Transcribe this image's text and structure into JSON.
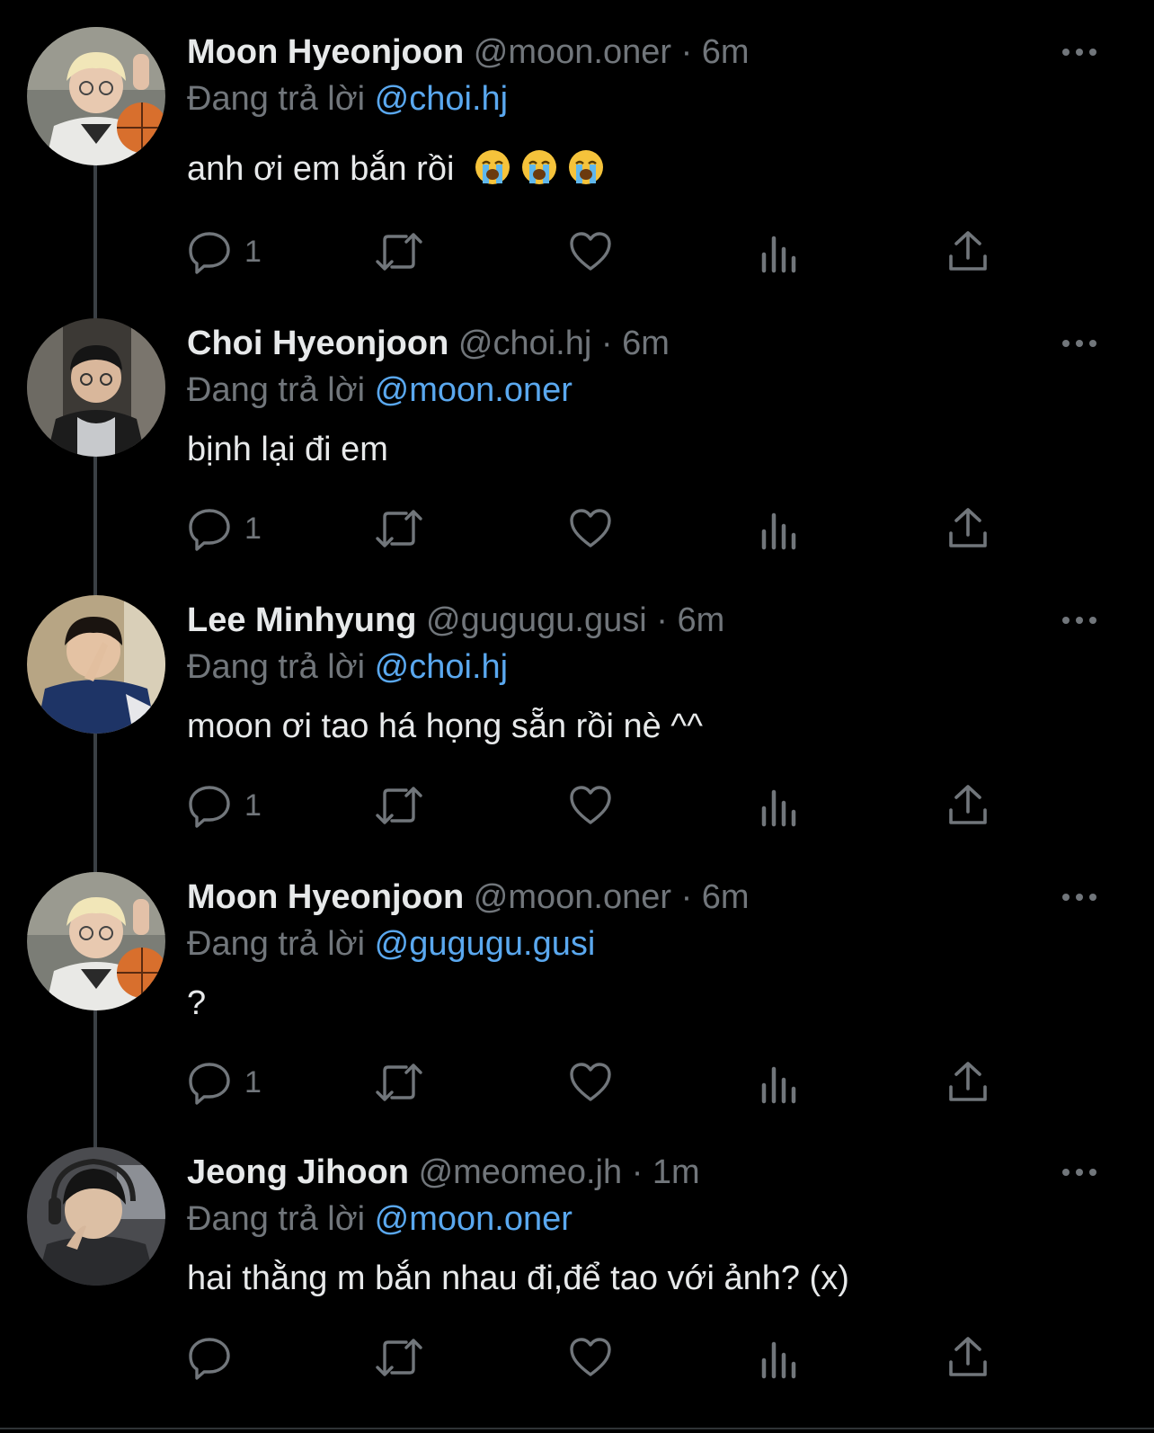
{
  "reply_prefix": "Đang trả lời",
  "colors": {
    "background": "#000000",
    "text": "#e7e9ea",
    "muted": "#71767b",
    "link": "#5aa8ef",
    "thread_line": "#3a3f44"
  },
  "icons": {
    "more": "more-horizontal-icon",
    "reply": "reply-bubble-icon",
    "retweet": "retweet-icon",
    "like": "heart-icon",
    "views": "bar-chart-icon",
    "share": "share-icon",
    "emoji": "loudly-crying-face-emoji"
  },
  "tweets": [
    {
      "name": "Moon Hyeonjoon",
      "handle": "@moon.oner",
      "separator": "·",
      "time": "6m",
      "reply_to": "@choi.hj",
      "text": "anh ơi em bắn rồi",
      "emojis": [
        "😭",
        "😭",
        "😭"
      ],
      "reply_count": "1"
    },
    {
      "name": "Choi Hyeonjoon",
      "handle": "@choi.hj",
      "separator": "·",
      "time": "6m",
      "reply_to": "@moon.oner",
      "text": "bịnh lại đi em",
      "reply_count": "1"
    },
    {
      "name": "Lee Minhyung",
      "handle": "@gugugu.gusi",
      "separator": "·",
      "time": "6m",
      "reply_to": "@choi.hj",
      "text": "moon ơi tao há họng sẵn rồi nè ^^",
      "reply_count": "1"
    },
    {
      "name": "Moon Hyeonjoon",
      "handle": "@moon.oner",
      "separator": "·",
      "time": "6m",
      "reply_to": "@gugugu.gusi",
      "text": "?",
      "reply_count": "1"
    },
    {
      "name": "Jeong Jihoon",
      "handle": "@meomeo.jh",
      "separator": "·",
      "time": "1m",
      "reply_to": "@moon.oner",
      "text": "hai thằng m bắn nhau đi,để tao với ảnh? (x)",
      "reply_count": ""
    }
  ]
}
